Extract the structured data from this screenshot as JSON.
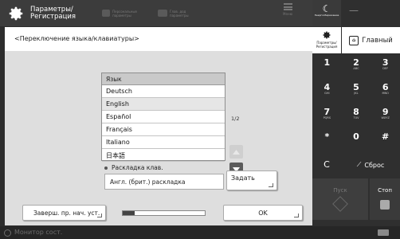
{
  "topbar": {
    "title": "Параметры/ Регистрация",
    "shortcut1": "Персональные параметры",
    "shortcut2": "Глав. дод параметры",
    "menu_label": "Меню"
  },
  "panel": {
    "header": "<Переключение языка/клавиатуры>",
    "list_header": "Язык",
    "languages": [
      "Deutsch",
      "English",
      "Español",
      "Français",
      "Italiano",
      "日本語"
    ],
    "selected_language": "English",
    "page_indicator": "1/2",
    "layout_label": "Раскладка клав.",
    "layout_value": "Англ. (брит.) раскладка",
    "set_button": "Задать",
    "reset_button": "Заверш. пр. нач. уст.",
    "progress_fraction": 0.15,
    "ok_button": "OK"
  },
  "statusbar": {
    "monitor": "Монитор сост."
  },
  "keypad": {
    "sleep_label": "Энергосбережение",
    "settings_label": "Параметры/ Регистрация",
    "home_label": "Главный",
    "keys": [
      {
        "num": "1",
        "sub": ""
      },
      {
        "num": "2",
        "sub": "ABC"
      },
      {
        "num": "3",
        "sub": "DEF"
      },
      {
        "num": "4",
        "sub": "GHI"
      },
      {
        "num": "5",
        "sub": "JKL"
      },
      {
        "num": "6",
        "sub": "MNO"
      },
      {
        "num": "7",
        "sub": "PQRS"
      },
      {
        "num": "8",
        "sub": "TUV"
      },
      {
        "num": "9",
        "sub": "WXYZ"
      },
      {
        "num": "*",
        "sub": ""
      },
      {
        "num": "0",
        "sub": ""
      },
      {
        "num": "#",
        "sub": ""
      }
    ],
    "clear": "C",
    "reset": "Сброс",
    "start": "Пуск",
    "stop": "Стоп"
  },
  "colors": {
    "accent": "#444444",
    "background": "#2d2d2d"
  }
}
